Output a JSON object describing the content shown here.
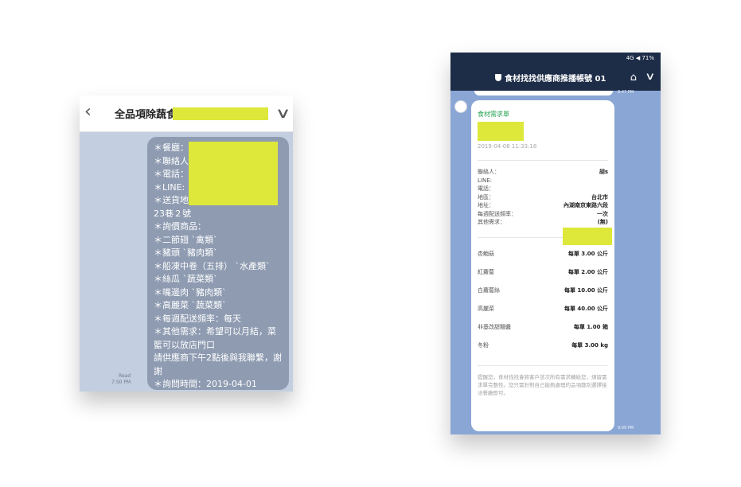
{
  "left": {
    "title": "全品項除蔬食",
    "read_label": "Read",
    "time": "7:50 PM",
    "message_lines": [
      "＊餐廳：",
      "＊聯絡人",
      "＊電話：",
      "＊LINE:",
      "＊送貨地",
      "23巷２號",
      "＊詢價商品：",
      "＊二節翅 `禽類`",
      "＊豬頭 `豬肉類`",
      "＊船凍中卷（五排） `水產類`",
      "＊絲瓜 `蔬菜類`",
      "＊嘴邊肉 `豬肉類`",
      "＊高麗菜 `蔬菜類`",
      "＊每週配送頻率：每天",
      "＊其他需求：希望可以月結，菜籃可以放店門口",
      "請供應商下午2點後與我聯繫，謝謝",
      "＊詢問時間：2019-04-01"
    ]
  },
  "right": {
    "status": "4G ◀ 71%",
    "nav_title": "食材找找供應商推播帳號 01",
    "time_top": "8:47 PM",
    "time_bottom": "9:09 PM",
    "card": {
      "title": "食材需求單",
      "date": "2019-04-08 11:33:18",
      "info": [
        {
          "label": "聯絡人：",
          "value": "胡s"
        },
        {
          "label": "LINE:",
          "value": ""
        },
        {
          "label": "電話：",
          "value": ""
        },
        {
          "label": "地區：",
          "value": "台北市"
        },
        {
          "label": "地址：",
          "value": "內湖南京東路六段"
        },
        {
          "label": "每週配送頻率：",
          "value": "一次"
        },
        {
          "label": "其他需求：",
          "value": "(無)"
        }
      ],
      "items": [
        {
          "name": "杏鮑菇",
          "qty": "每單 3.00 公斤"
        },
        {
          "name": "紅蘿蔔",
          "qty": "每單 2.00 公斤"
        },
        {
          "name": "白蘿蔔絲",
          "qty": "每單 10.00 公斤"
        },
        {
          "name": "高麗菜",
          "qty": "每單 40.00 公斤"
        },
        {
          "name": "非基改甜麵醬",
          "qty": "每單 1.00 箱"
        },
        {
          "name": "冬粉",
          "qty": "每單 3.00 kg"
        }
      ],
      "note": "提醒您，食材找找會將客戶該次所有需求轉給您，煩留需求單完整性。您只需針對自己能夠處理的品項篩別選擇接洽餐廳即可。"
    }
  }
}
